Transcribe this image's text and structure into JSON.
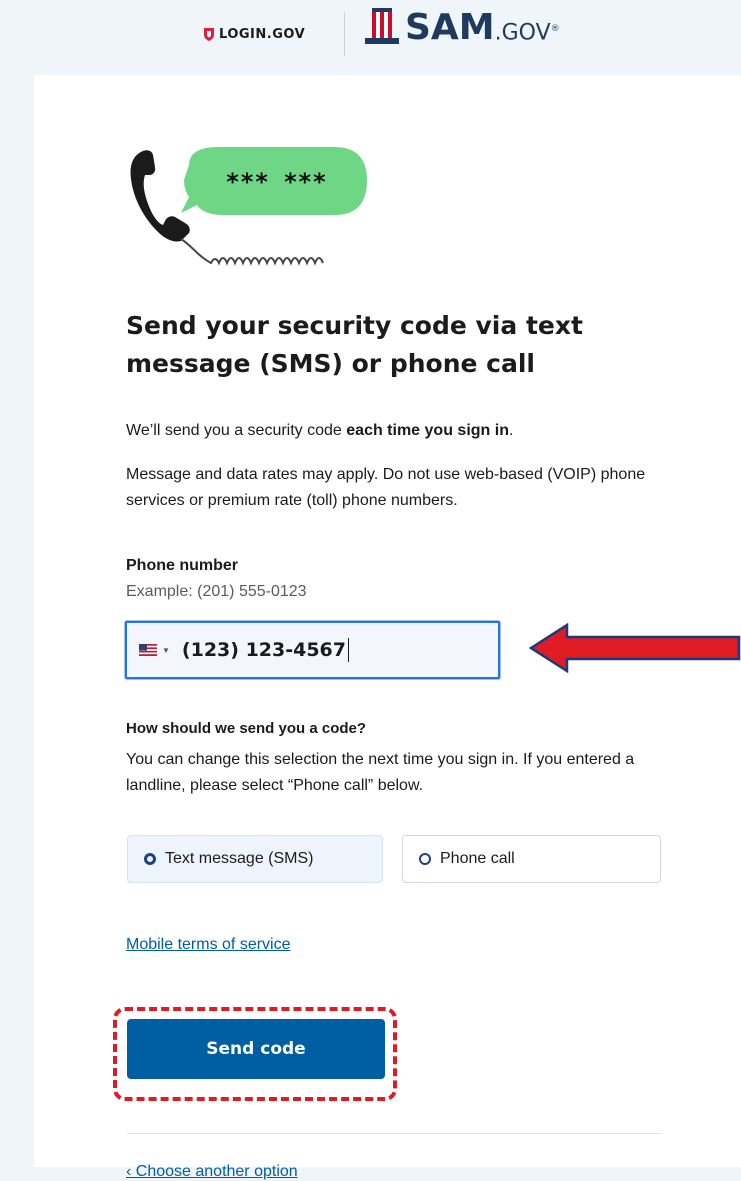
{
  "header": {
    "login_logo_text": "LOGIN.GOV",
    "sam_logo_text": "SAM",
    "sam_logo_suffix": ".GOV",
    "sam_logo_mark": "®"
  },
  "illustration": {
    "bubble_text": "*** ***",
    "bubble_color": "#6fd686"
  },
  "page": {
    "title": "Send your security code via text message (SMS) or phone call",
    "intro_prefix": "We’ll send you a security code ",
    "intro_bold": "each time you sign in",
    "intro_suffix": ".",
    "rates_notice": "Message and data rates may apply. Do not use web-based (VOIP) phone services or premium rate (toll) phone numbers."
  },
  "phone": {
    "label": "Phone number",
    "hint": "Example: (201) 555-0123",
    "value": "(123) 123-4567",
    "country_flag": "us-flag-icon"
  },
  "delivery": {
    "label": "How should we send you a code?",
    "description": "You can change this selection the next time you sign in. If you entered a landline, please select “Phone call” below.",
    "options": [
      {
        "label": "Text message (SMS)",
        "selected": true
      },
      {
        "label": "Phone call",
        "selected": false
      }
    ]
  },
  "links": {
    "terms": "Mobile terms of service",
    "back": "‹ Choose another option"
  },
  "actions": {
    "send_label": "Send code"
  },
  "colors": {
    "primary": "#005ea2",
    "annotation_red": "#e01b24",
    "focus_blue": "#2672de"
  }
}
